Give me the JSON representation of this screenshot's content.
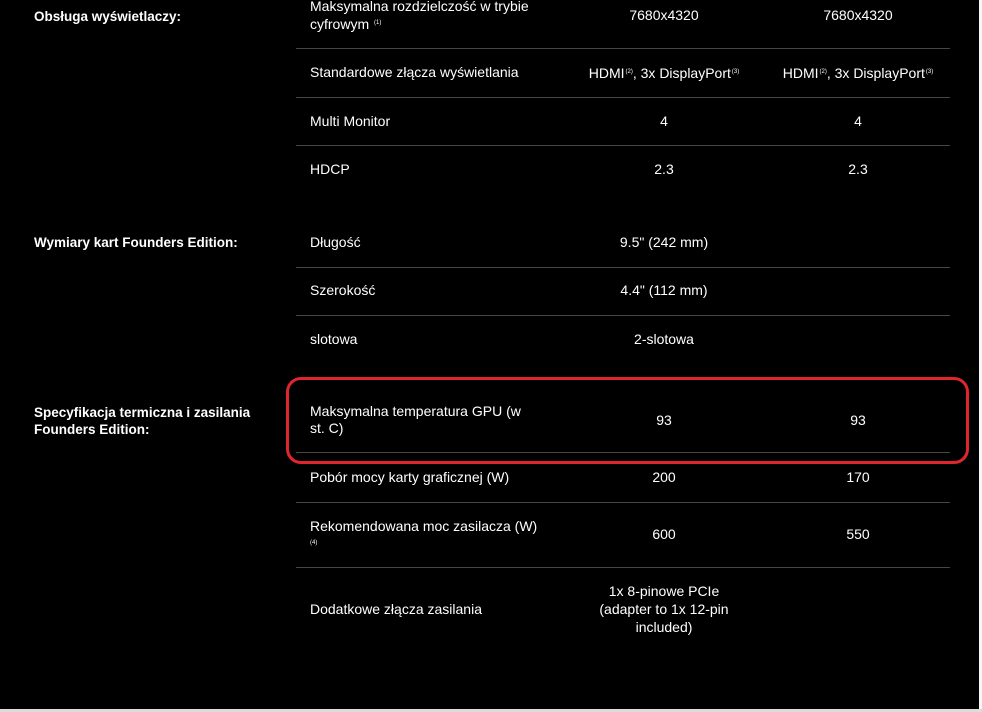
{
  "sections": {
    "display": "Obsługa wyświetlaczy:",
    "dimensions": "Wymiary kart Founders Edition:",
    "thermal_line1": "Specyfikacja termiczna i zasilania",
    "thermal_line2": "Founders Edition:"
  },
  "rows": {
    "max_res": {
      "label_line1": "Maksymalna rozdzielczość w trybie",
      "label_line2": "cyfrowym",
      "note": "(1)",
      "v1": "7680x4320",
      "v2": "7680x4320"
    },
    "connectors": {
      "label": "Standardowe złącza wyświetlania",
      "v1_a": "HDMI",
      "v1_note_a": "(2)",
      "v1_b": ", 3x DisplayPort",
      "v1_note_b": "(3)",
      "v2_a": "HDMI",
      "v2_note_a": "(2)",
      "v2_b": ", 3x DisplayPort",
      "v2_note_b": "(3)"
    },
    "multi_monitor": {
      "label": "Multi Monitor",
      "v1": "4",
      "v2": "4"
    },
    "hdcp": {
      "label": "HDCP",
      "v1": "2.3",
      "v2": "2.3"
    },
    "length": {
      "label": "Długość",
      "v": "9.5\" (242 mm)"
    },
    "width": {
      "label": "Szerokość",
      "v": "4.4\" (112 mm)"
    },
    "slot": {
      "label": "slotowa",
      "v": "2-slotowa"
    },
    "max_temp": {
      "label_line1": "Maksymalna temperatura GPU (w",
      "label_line2": "st. C)",
      "v1": "93",
      "v2": "93"
    },
    "power_draw": {
      "label": "Pobór mocy karty graficznej (W)",
      "v1": "200",
      "v2": "170"
    },
    "psu": {
      "label": "Rekomendowana moc zasilacza (W)",
      "note": "(4)",
      "v1": "600",
      "v2": "550"
    },
    "aux_power": {
      "label": "Dodatkowe złącza zasilania",
      "v_line1": "1x 8-pinowe PCIe",
      "v_line2": "(adapter to 1x 12-pin",
      "v_line3": "included)"
    }
  },
  "colors": {
    "background": "#000000",
    "text": "#ffffff",
    "divider": "#454545",
    "highlight": "#e0262d"
  }
}
